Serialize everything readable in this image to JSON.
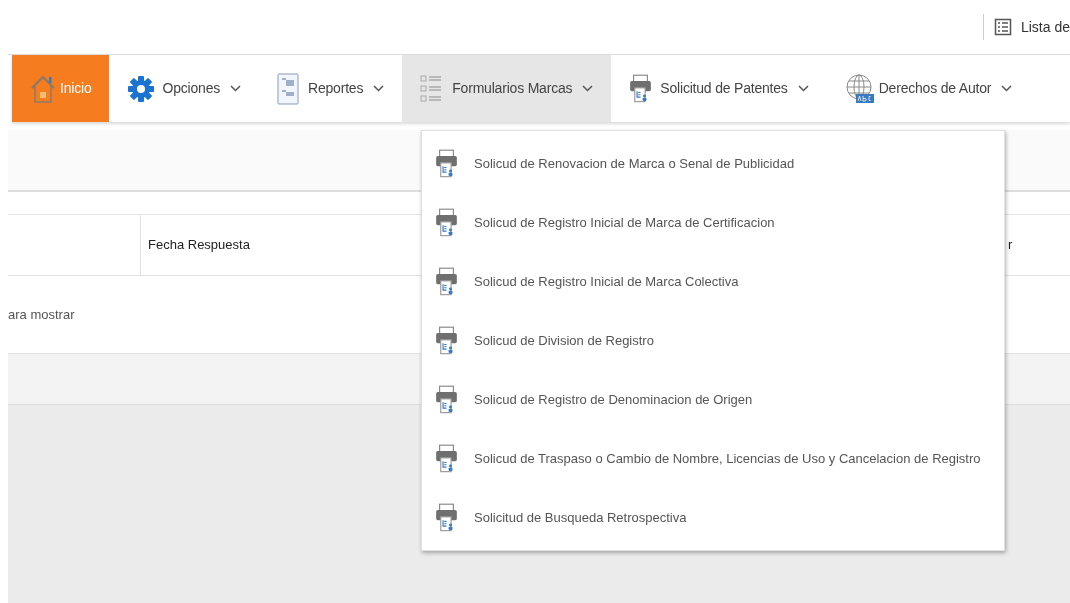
{
  "top_bar": {
    "link": "Lista de"
  },
  "nav": [
    {
      "label": "Inicio",
      "kind": "home",
      "active": true,
      "expanded": false,
      "caret": false
    },
    {
      "label": "Opciones",
      "kind": "gear",
      "active": false,
      "expanded": false,
      "caret": true
    },
    {
      "label": "Reportes",
      "kind": "report",
      "active": false,
      "expanded": false,
      "caret": true
    },
    {
      "label": "Formularios Marcas",
      "kind": "list",
      "active": false,
      "expanded": true,
      "caret": true
    },
    {
      "label": "Solicitud de Patentes",
      "kind": "printer",
      "active": false,
      "expanded": false,
      "caret": true
    },
    {
      "label": "Derechos de Autor",
      "kind": "globe",
      "active": false,
      "expanded": false,
      "caret": true
    }
  ],
  "table": {
    "columns": [
      "Fecha Respuesta",
      "r"
    ],
    "empty_message": "ara mostrar"
  },
  "dropdown": {
    "items": [
      "Solicud de Renovacion de Marca o Senal de Publicidad",
      "Solicud de Registro Inicial de Marca de Certificacion",
      "Solicud de Registro Inicial de Marca Colectiva",
      "Solicud de Division de Registro",
      "Solicud de Registro de Denominacion de Origen",
      "Solicud de Traspaso o Cambio de Nombre, Licencias de Uso y Cancelacion de Registro",
      "Solicitud de Busqueda Retrospectiva"
    ]
  }
}
